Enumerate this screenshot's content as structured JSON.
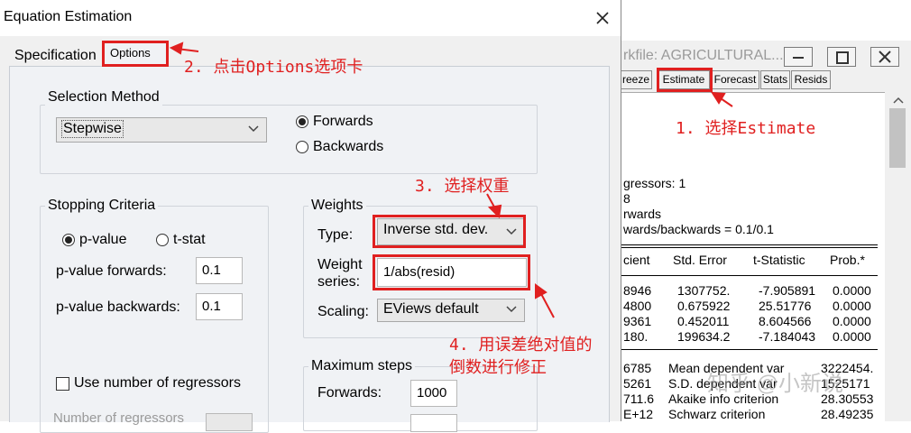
{
  "dialog": {
    "title": "Equation Estimation",
    "tabs": {
      "specification": "Specification",
      "options": "Options"
    },
    "selection_method": {
      "group_title": "Selection Method",
      "method_value": "Stepwise",
      "forwards_label": "Forwards",
      "backwards_label": "Backwards",
      "selected": "Forwards"
    },
    "stopping_criteria": {
      "group_title": "Stopping Criteria",
      "pvalue_label": "p-value",
      "tstat_label": "t-stat",
      "selected": "p-value",
      "pvalue_forwards_label": "p-value forwards:",
      "pvalue_forwards_value": "0.1",
      "pvalue_backwards_label": "p-value backwards:",
      "pvalue_backwards_value": "0.1",
      "use_number_label": "Use number of regressors",
      "number_regressors_label": "Number of regressors"
    },
    "weights": {
      "group_title": "Weights",
      "type_label": "Type:",
      "type_value": "Inverse std. dev.",
      "series_label_1": "Weight",
      "series_label_2": "series:",
      "series_value": "1/abs(resid)",
      "scaling_label": "Scaling:",
      "scaling_value": "EViews default"
    },
    "max_steps": {
      "group_title": "Maximum steps",
      "forwards_label": "Forwards:",
      "forwards_value": "1000"
    }
  },
  "workfile": {
    "title": "rkfile: AGRICULTURAL...",
    "toolbar": [
      "reeze",
      "Estimate",
      "Forecast",
      "Stats",
      "Resids"
    ],
    "output_lines": [
      "gressors: 1",
      "8",
      "rwards",
      "wards/backwards = 0.1/0.1"
    ],
    "table_headers": [
      "cient",
      "Std. Error",
      "t-Statistic",
      "Prob.*"
    ],
    "table_rows": [
      [
        "8946",
        "1307752.",
        "-7.905891",
        "0.0000"
      ],
      [
        "4800",
        "0.675922",
        "25.51776",
        "0.0000"
      ],
      [
        "9361",
        "0.452011",
        "8.604566",
        "0.0000"
      ],
      [
        "180.",
        "199634.2",
        "-7.184043",
        "0.0000"
      ]
    ],
    "stats_rows": [
      [
        "6785",
        "Mean dependent var",
        "3222454."
      ],
      [
        "5261",
        "S.D. dependent var",
        "1525171"
      ],
      [
        "711.6",
        "Akaike info criterion",
        "28.30553"
      ],
      [
        "E+12",
        "Schwarz criterion",
        "28.49235"
      ]
    ],
    "watermark": "知乎 @小新说"
  },
  "annotations": {
    "step1": "1. 选择Estimate",
    "step2": "2. 点击Options选项卡",
    "step3": "3. 选择权重",
    "step4_line1": "4. 用误差绝对值的",
    "step4_line2": "倒数进行修正"
  },
  "colors": {
    "annotation_red": "#e02020"
  }
}
